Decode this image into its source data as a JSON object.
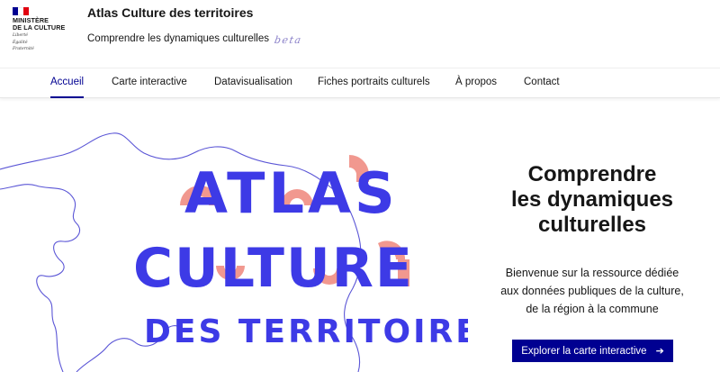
{
  "header": {
    "logo": {
      "ministry_line1": "MINISTÈRE",
      "ministry_line2": "DE LA CULTURE",
      "motto": [
        "Liberté",
        "Égalité",
        "Fraternité"
      ],
      "flag_colors": [
        "#000091",
        "#ffffff",
        "#e1000f"
      ]
    },
    "site_title": "Atlas Culture des territoires",
    "tagline": "Comprendre les dynamiques culturelles",
    "beta_label": "beta"
  },
  "nav": {
    "items": [
      {
        "label": "Accueil",
        "active": true
      },
      {
        "label": "Carte interactive",
        "active": false
      },
      {
        "label": "Datavisualisation",
        "active": false
      },
      {
        "label": "Fiches portraits culturels",
        "active": false
      },
      {
        "label": "À propos",
        "active": false
      },
      {
        "label": "Contact",
        "active": false
      }
    ]
  },
  "hero": {
    "art": {
      "word1": "ATLAS",
      "word2": "CULTURE",
      "word3": "DES TERRITOIRES"
    },
    "heading_lines": [
      "Comprendre",
      "les dynamiques",
      "culturelles"
    ],
    "text_lines": [
      "Bienvenue sur la ressource dédiée",
      "aux données publiques de la culture,",
      "de la région à la commune"
    ],
    "cta_label": "Explorer la carte interactive",
    "cta_icon": "arrow-right-icon",
    "colors": {
      "accent": "#000091",
      "art_blue": "#3d3ae6",
      "art_pink": "#f08f86"
    }
  }
}
